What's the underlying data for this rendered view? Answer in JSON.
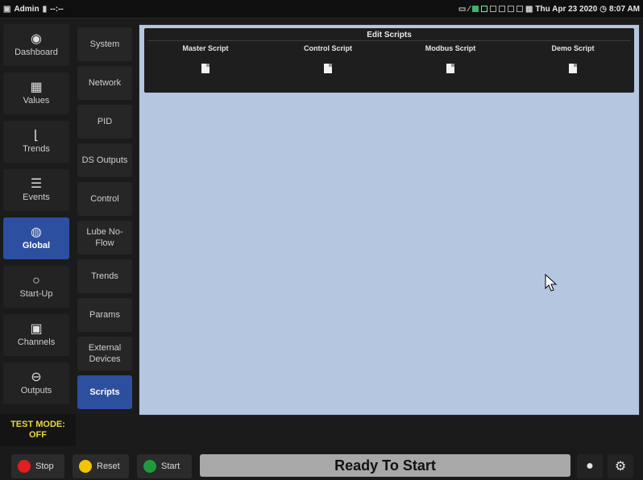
{
  "topbar": {
    "title": "Admin",
    "title_suffix": "--:--",
    "datetime": "Thu Apr 23 2020",
    "time": "8:07 AM"
  },
  "left_nav": [
    {
      "label": "Dashboard",
      "icon": "gauge-icon"
    },
    {
      "label": "Values",
      "icon": "grid-icon"
    },
    {
      "label": "Trends",
      "icon": "chart-icon"
    },
    {
      "label": "Events",
      "icon": "list-icon"
    },
    {
      "label": "Global",
      "icon": "globe-icon",
      "active": true
    },
    {
      "label": "Start-Up",
      "icon": "refresh-icon"
    },
    {
      "label": "Channels",
      "icon": "channels-icon"
    },
    {
      "label": "Outputs",
      "icon": "output-icon"
    }
  ],
  "test_mode": {
    "line1": "TEST MODE:",
    "line2": "OFF"
  },
  "sub_nav": [
    {
      "label": "System"
    },
    {
      "label": "Network"
    },
    {
      "label": "PID"
    },
    {
      "label": "DS Outputs"
    },
    {
      "label": "Control"
    },
    {
      "label": "Lube No-Flow"
    },
    {
      "label": "Trends"
    },
    {
      "label": "Params"
    },
    {
      "label": "External Devices"
    },
    {
      "label": "Scripts",
      "active": true
    }
  ],
  "scripts_panel": {
    "title": "Edit Scripts",
    "columns": [
      "Master Script",
      "Control Script",
      "Modbus Script",
      "Demo Script"
    ]
  },
  "bottom": {
    "stop_label": "Stop",
    "reset_label": "Reset",
    "start_label": "Start",
    "status": "Ready To Start"
  },
  "colors": {
    "active_nav": "#2d4fa0",
    "main_bg": "#b4c6e0",
    "stop": "#e02020",
    "reset": "#f0c400",
    "start": "#1f9a3a",
    "test_mode": "#e7d845"
  }
}
